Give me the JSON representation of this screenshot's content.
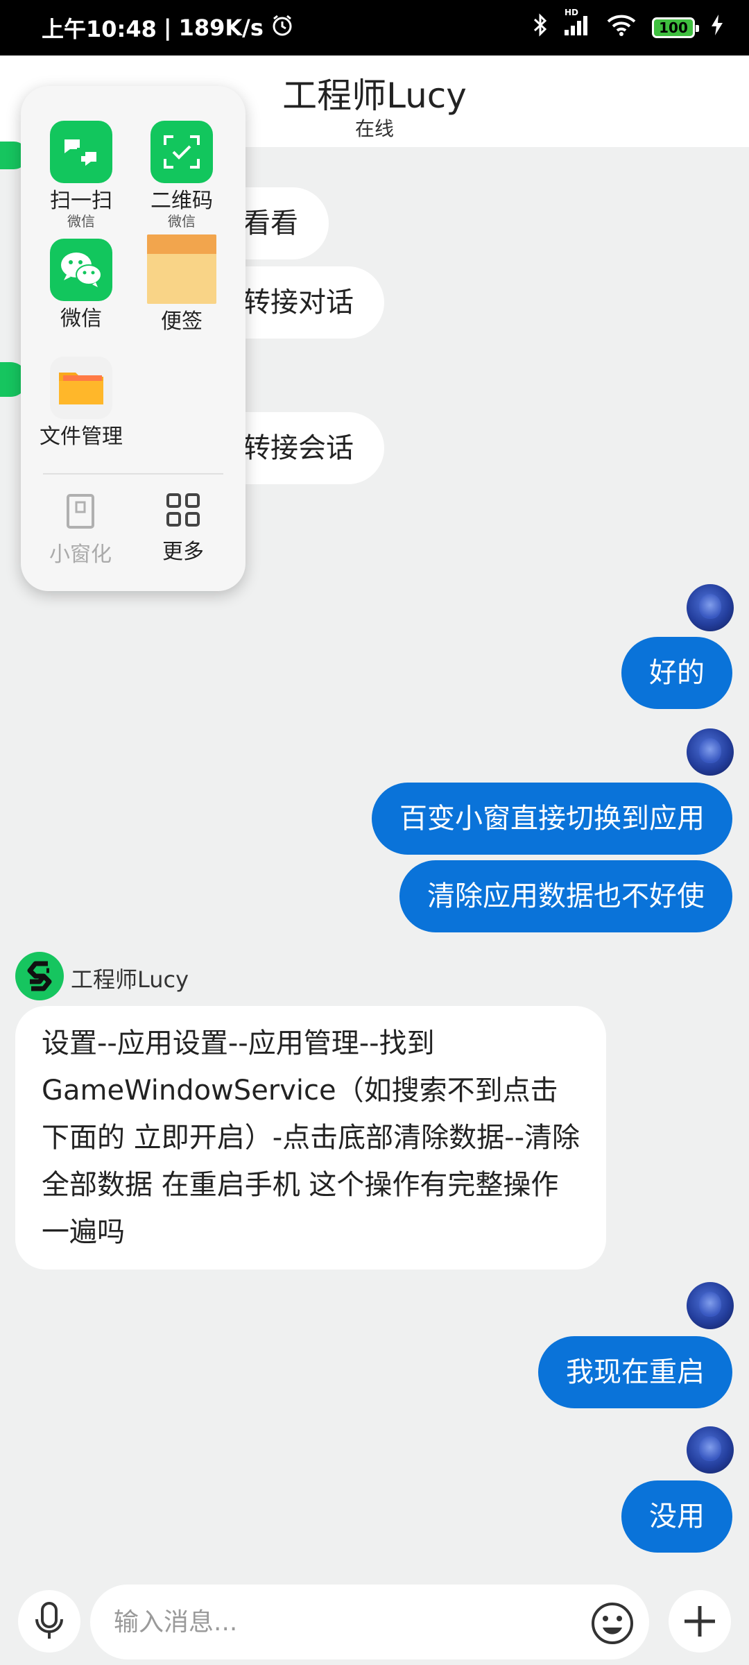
{
  "status_bar": {
    "time": "上午10:48",
    "separator": "|",
    "speed": "189K/s",
    "hd_label": "HD",
    "battery": "100"
  },
  "header": {
    "title": "工程师Lucy",
    "subtitle": "在线"
  },
  "messages": {
    "partial_1": "看看",
    "partial_2": "转接对话",
    "partial_3": "转接会话",
    "user_1": "好的",
    "user_2": "百变小窗直接切换到应用",
    "user_3": "清除应用数据也不好使",
    "agent_name": "工程师Lucy",
    "agent_1": "设置--应用设置--应用管理--找到GameWindowService（如搜索不到点击下面的 立即开启）-点击底部清除数据--清除全部数据  在重启手机   这个操作有完整操作一遍吗",
    "user_4": "我现在重启",
    "user_5": "没用"
  },
  "popup": {
    "apps": [
      {
        "label": "扫一扫",
        "sub": "微信",
        "icon": "scan-icon"
      },
      {
        "label": "二维码",
        "sub": "微信",
        "icon": "qr-code-icon"
      },
      {
        "label": "微信",
        "icon": "wechat-icon"
      },
      {
        "label": "便签",
        "icon": "notes-icon"
      },
      {
        "label": "文件管理",
        "icon": "folder-icon"
      }
    ],
    "tools": [
      {
        "label": "小窗化",
        "icon": "small-window-icon"
      },
      {
        "label": "更多",
        "icon": "grid-icon"
      }
    ]
  },
  "input": {
    "placeholder": "输入消息..."
  },
  "colors": {
    "accent": "#0a73d9",
    "wechat_green": "#16c55f",
    "background": "#eff0f0"
  }
}
